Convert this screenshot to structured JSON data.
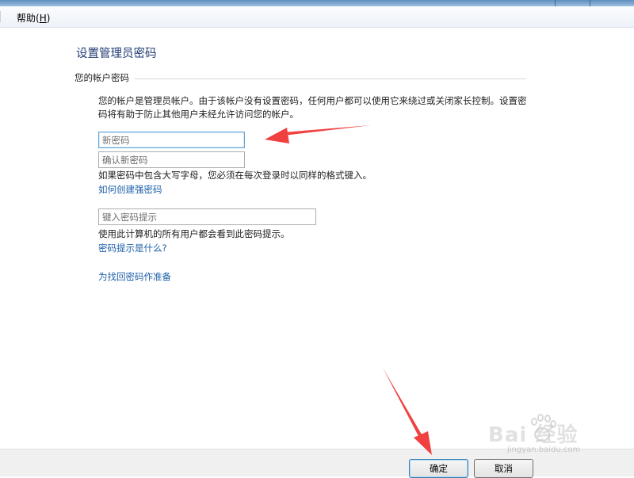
{
  "menu": {
    "help_label": "帮助(",
    "help_key": "H",
    "help_close": ")"
  },
  "page": {
    "title": "设置管理员密码",
    "section_label": "您的帐户密码",
    "description": "您的帐户是管理员帐户。由于该帐户没有设置密码，任何用户都可以使用它来绕过或关闭家长控制。设置密码将有助于防止其他用户未经允许访问您的帐户。"
  },
  "fields": {
    "new_password": {
      "placeholder": "新密码",
      "value": ""
    },
    "confirm_password": {
      "placeholder": "确认新密码",
      "value": ""
    },
    "hint": {
      "placeholder": "键入密码提示",
      "value": ""
    }
  },
  "notes": {
    "case_note": "如果密码中包含大写字母，您必须在每次登录时以同样的格式键入。",
    "hint_note": "使用此计算机的所有用户都会看到此密码提示。"
  },
  "links": {
    "strong_password": "如何创建强密码",
    "what_is_hint": "密码提示是什么?",
    "prepare_reset": "为找回密码作准备"
  },
  "buttons": {
    "ok": "确定",
    "cancel": "取消"
  },
  "watermark": {
    "brand": "Bai   经验",
    "url": "jingyan.baidu.com"
  },
  "colors": {
    "title": "#1f3b73",
    "link": "#1c5fa8",
    "arrow": "#f04040"
  }
}
